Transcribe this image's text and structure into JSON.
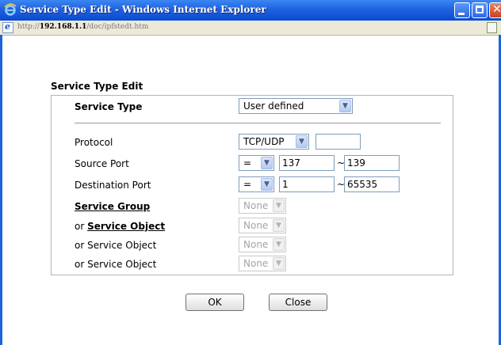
{
  "window": {
    "title": "Service Type Edit - Windows Internet Explorer",
    "url_prefix": "http://",
    "url_host": "192.168.1.1",
    "url_path": "/doc/ipfstedt.htm"
  },
  "form": {
    "section_title": "Service Type Edit",
    "service_type": {
      "label": "Service Type",
      "value": "User defined"
    },
    "protocol": {
      "label": "Protocol",
      "value": "TCP/UDP",
      "extra": ""
    },
    "source_port": {
      "label": "Source Port",
      "operator": "=",
      "from": "137",
      "separator": "~",
      "to": "139"
    },
    "destination_port": {
      "label": "Destination Port",
      "operator": "=",
      "from": "1",
      "separator": "~",
      "to": "65535"
    },
    "service_group": {
      "label": "Service Group",
      "value": "None"
    },
    "service_object_1": {
      "prefix": "or",
      "label": "Service Object",
      "value": "None"
    },
    "service_object_2": {
      "label": "or Service Object",
      "value": "None"
    },
    "service_object_3": {
      "label": "or Service Object",
      "value": "None"
    }
  },
  "buttons": {
    "ok": "OK",
    "close": "Close"
  },
  "icons": {
    "dropdown": "chevron-down-icon",
    "browser": "ie-icon"
  }
}
